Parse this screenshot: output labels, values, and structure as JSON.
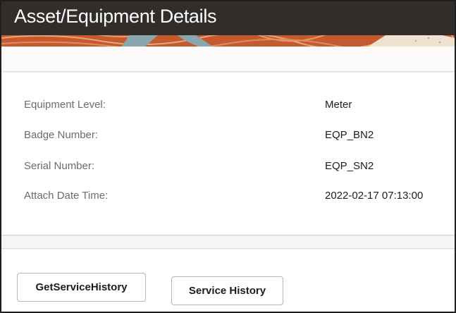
{
  "header": {
    "title": "Asset/Equipment Details"
  },
  "details": {
    "rows": [
      {
        "label": "Equipment Level:",
        "value": "Meter"
      },
      {
        "label": "Badge Number:",
        "value": "EQP_BN2"
      },
      {
        "label": "Serial Number:",
        "value": "EQP_SN2"
      },
      {
        "label": "Attach Date Time:",
        "value": "2022-02-17 07:13:00"
      }
    ]
  },
  "actions": {
    "get_service_history_label": "GetServiceHistory",
    "service_history_label": "Service History"
  },
  "colors": {
    "title_bar": "#312d2a",
    "banner_accent": "#c45a2e",
    "banner_teal": "#8aa7ad",
    "label_text": "#6f6b66",
    "value_text": "#1f1d1b"
  }
}
